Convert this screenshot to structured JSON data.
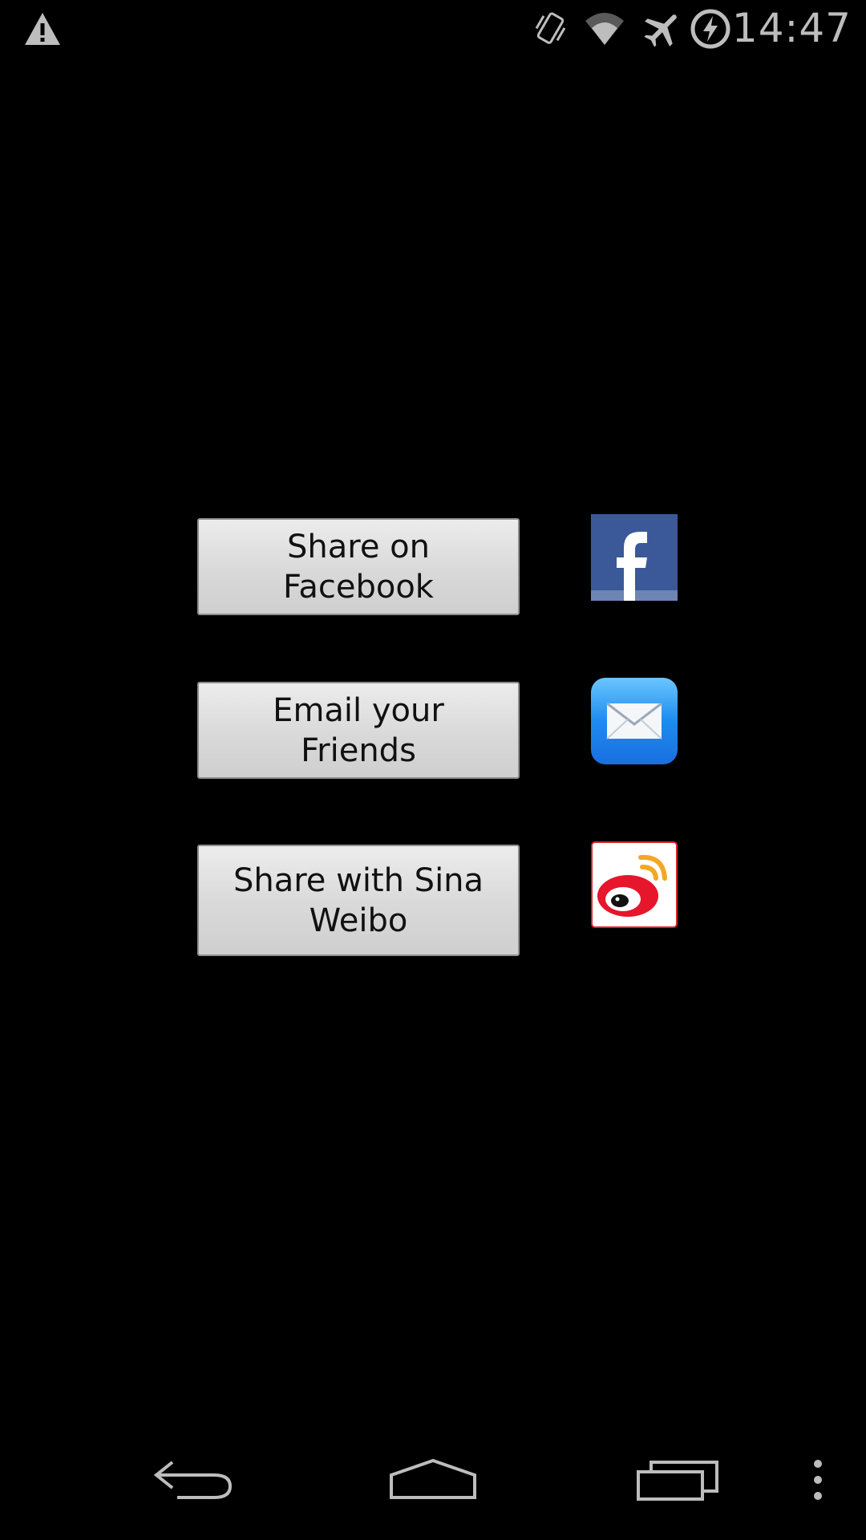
{
  "status_bar": {
    "time": "14:47",
    "icons": [
      "warning-icon",
      "vibrate-icon",
      "wifi-icon",
      "airplane-mode-icon",
      "data-saver-icon"
    ]
  },
  "share_options": [
    {
      "label": "Share on Facebook",
      "icon": "facebook-icon",
      "color": "#3b5998"
    },
    {
      "label": "Email your Friends",
      "icon": "mail-icon",
      "color": "#1e90ff"
    },
    {
      "label": "Share with Sina Weibo",
      "icon": "sina-weibo-icon",
      "color": "#e6162d"
    }
  ],
  "nav_bar": {
    "buttons": [
      "back-icon",
      "home-icon",
      "recents-icon",
      "overflow-menu-icon"
    ]
  },
  "colors": {
    "background": "#000000",
    "button_face": "#dcdcdc",
    "status_icon": "#bdbdbd"
  }
}
